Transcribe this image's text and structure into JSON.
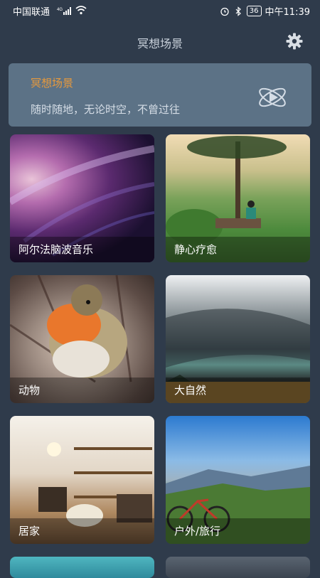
{
  "status_bar": {
    "carrier": "中国联通",
    "network": "4G",
    "battery": "36",
    "time": "中午11:39"
  },
  "header": {
    "title": "冥想场景",
    "settings_icon": "gear-icon"
  },
  "banner": {
    "title": "冥想场景",
    "subtitle": "随时随地，无论时空，不曾过往",
    "icon": "atom-play-icon",
    "title_color": "#e89a3c",
    "background": "#5c7286"
  },
  "categories": [
    {
      "label": "阿尔法脑波音乐"
    },
    {
      "label": "静心疗愈"
    },
    {
      "label": "动物"
    },
    {
      "label": "大自然"
    },
    {
      "label": "居家"
    },
    {
      "label": "户外/旅行"
    }
  ],
  "theme": {
    "background": "#2f3b4b"
  }
}
